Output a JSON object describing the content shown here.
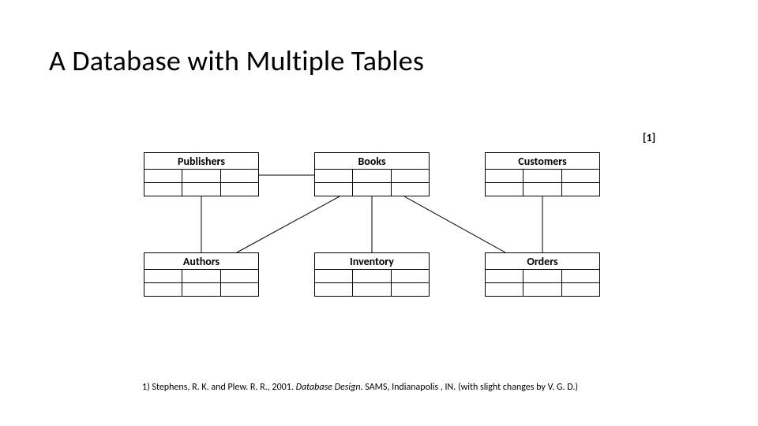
{
  "title": "A Database with Multiple Tables",
  "ref_marker": "[1]",
  "tables": {
    "publishers": "Publishers",
    "books": "Books",
    "customers": "Customers",
    "authors": "Authors",
    "inventory": "Inventory",
    "orders": "Orders"
  },
  "citation": {
    "prefix": "1) Stephens, R. K. and Plew. R. R., 2001. ",
    "title": "Database Design.",
    "suffix": " SAMS, Indianapolis , IN. (with slight changes by V. G. D.)"
  },
  "relationships": [
    [
      "publishers",
      "books"
    ],
    [
      "publishers",
      "authors"
    ],
    [
      "books",
      "inventory"
    ],
    [
      "books",
      "authors"
    ],
    [
      "books",
      "orders"
    ],
    [
      "customers",
      "orders"
    ]
  ],
  "grid": {
    "rows": 2,
    "cols": 3
  }
}
